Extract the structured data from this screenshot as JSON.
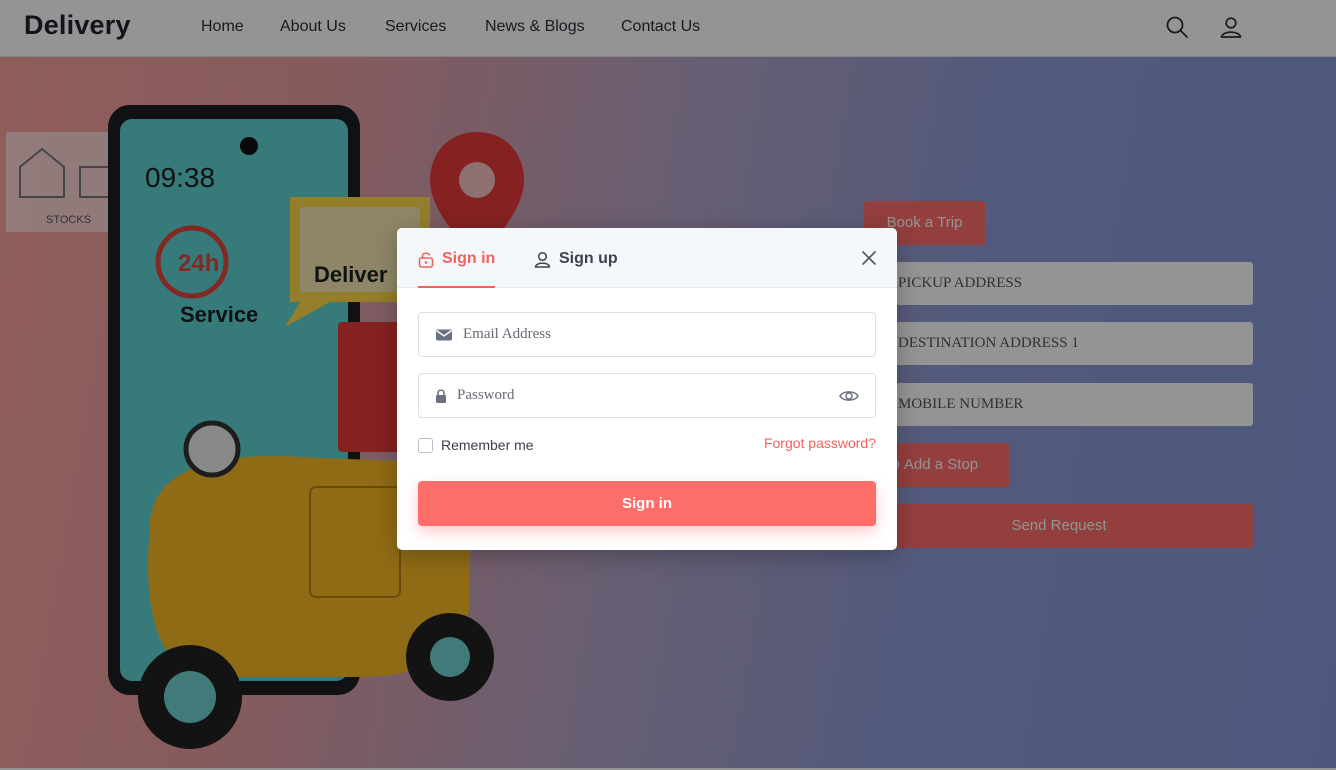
{
  "navbar": {
    "brand": "Delivery",
    "items": [
      "Home",
      "About Us",
      "Services",
      "News & Blogs",
      "Contact Us"
    ],
    "icons": [
      "search-icon",
      "user-icon"
    ]
  },
  "hero": {
    "art": {
      "clock": "09:38",
      "badge": "24h",
      "service_label": "Service",
      "delivery_label": "Deliver",
      "stocks_label": "STOCKS"
    },
    "book_trip_label": "Book a Trip",
    "pickup_placeholder": "PICKUP ADDRESS",
    "destination_placeholder": "DESTINATION ADDRESS 1",
    "mobile_placeholder": "MOBILE NUMBER",
    "add_stop_label": "Add a Stop",
    "send_request_label": "Send Request"
  },
  "modal": {
    "tab_signin": "Sign in",
    "tab_signup": "Sign up",
    "email_placeholder": "Email Address",
    "password_placeholder": "Password",
    "remember_label": "Remember me",
    "forgot_label": "Forgot password?",
    "submit_label": "Sign in"
  },
  "colors": {
    "accent": "#fd6d69",
    "accent_text": "#f2625d",
    "overlay": "rgba(0,0,0,0.42)"
  }
}
